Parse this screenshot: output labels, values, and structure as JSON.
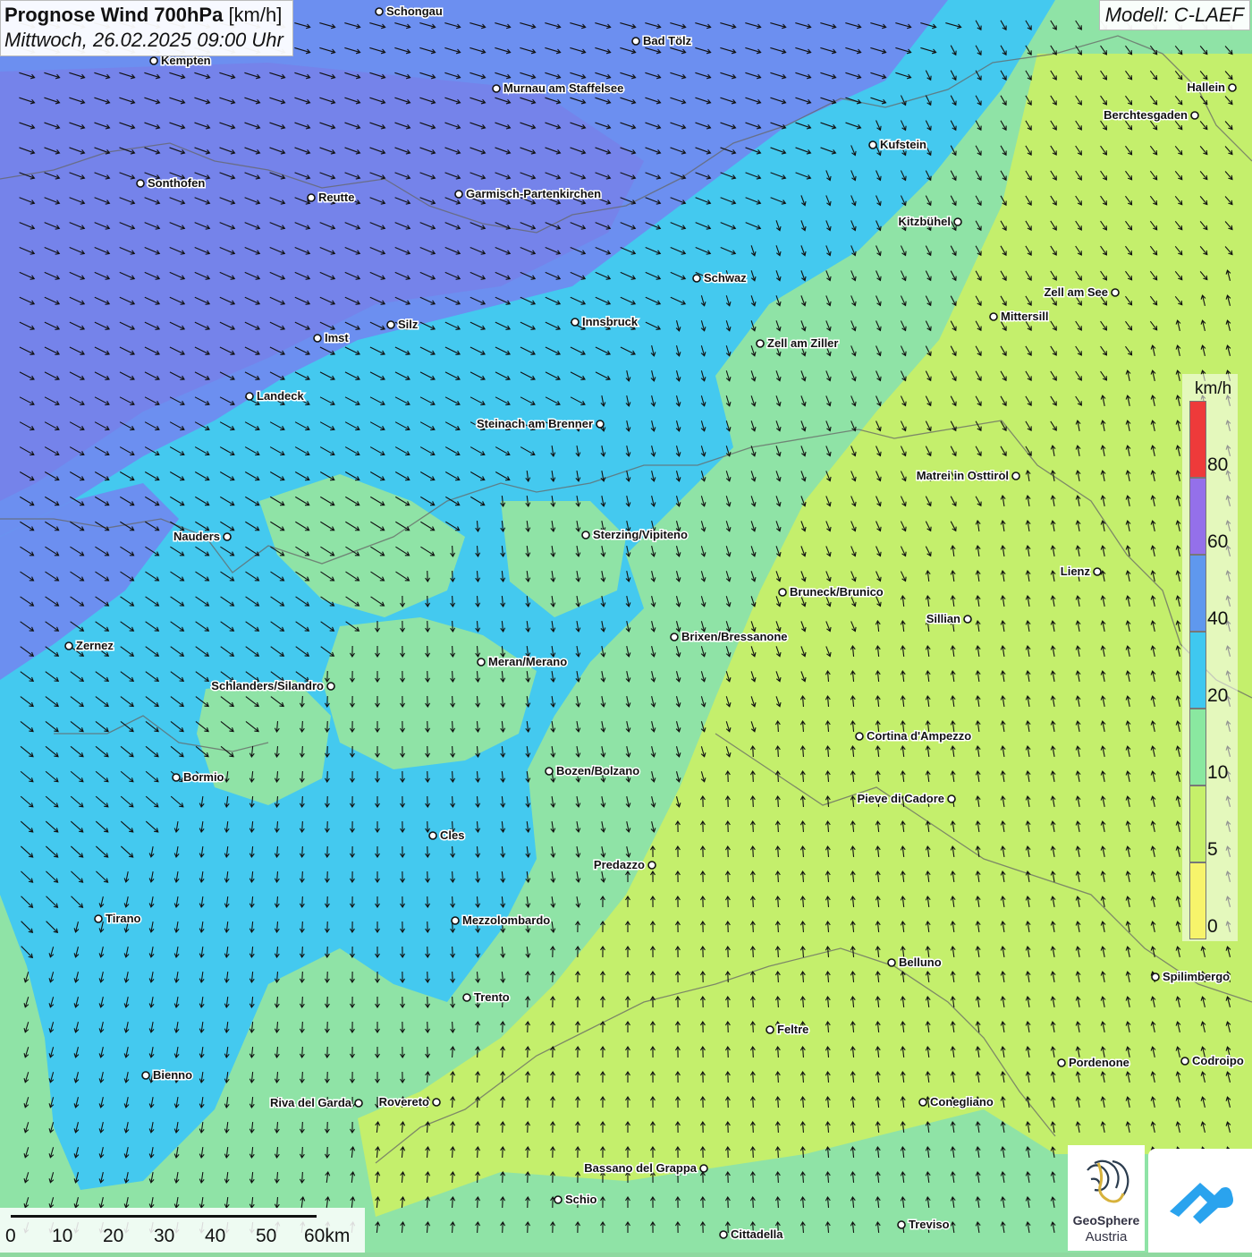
{
  "header": {
    "title_bold": "Prognose Wind 700hPa",
    "title_unit": "[km/h]",
    "datetime": "Mittwoch, 26.02.2025 09:00 Uhr",
    "model": "Modell: C-LAEF"
  },
  "legend": {
    "unit": "km/h",
    "ticks": [
      "0",
      "5",
      "10",
      "20",
      "40",
      "60",
      "80"
    ],
    "colors": [
      "#f7f46b",
      "#c6f06a",
      "#8ae8a0",
      "#3fc8f0",
      "#5f98ee",
      "#9470ea",
      "#ee3a3a"
    ]
  },
  "scale_bar": {
    "labels": [
      "0",
      "10",
      "20",
      "30",
      "40",
      "50",
      "60km"
    ]
  },
  "logo": {
    "name_line1": "GeoSphere",
    "name_line2": "Austria"
  },
  "cities": [
    {
      "name": "Schongau"
    },
    {
      "name": "Bad Tölz"
    },
    {
      "name": "Kempten"
    },
    {
      "name": "Murnau am Staffelsee"
    },
    {
      "name": "Hallein"
    },
    {
      "name": "Berchtesgaden"
    },
    {
      "name": "Kufstein"
    },
    {
      "name": "Sonthofen"
    },
    {
      "name": "Reutte"
    },
    {
      "name": "Garmisch-Partenkirchen"
    },
    {
      "name": "Kitzbühel"
    },
    {
      "name": "Schwaz"
    },
    {
      "name": "Zell am See"
    },
    {
      "name": "Mittersill"
    },
    {
      "name": "Innsbruck"
    },
    {
      "name": "Silz"
    },
    {
      "name": "Imst"
    },
    {
      "name": "Zell am Ziller"
    },
    {
      "name": "Landeck"
    },
    {
      "name": "Steinach am Brenner"
    },
    {
      "name": "Matrei in Osttirol"
    },
    {
      "name": "Nauders"
    },
    {
      "name": "Sterzing/Vipiteno"
    },
    {
      "name": "Lienz"
    },
    {
      "name": "Bruneck/Brunico"
    },
    {
      "name": "Sillian"
    },
    {
      "name": "Brixen/Bressanone"
    },
    {
      "name": "Zernez"
    },
    {
      "name": "Meran/Merano"
    },
    {
      "name": "Schlanders/Silandro"
    },
    {
      "name": "Cortina d'Ampezzo"
    },
    {
      "name": "Bozen/Bolzano"
    },
    {
      "name": "Bormio"
    },
    {
      "name": "Pieve di Cadore"
    },
    {
      "name": "Cles"
    },
    {
      "name": "Predazzo"
    },
    {
      "name": "Tirano"
    },
    {
      "name": "Mezzolombardo"
    },
    {
      "name": "Belluno"
    },
    {
      "name": "Spilimbergo"
    },
    {
      "name": "Trento"
    },
    {
      "name": "Feltre"
    },
    {
      "name": "Pordenone"
    },
    {
      "name": "Codroipo"
    },
    {
      "name": "Bienno"
    },
    {
      "name": "Riva del Garda"
    },
    {
      "name": "Rovereto"
    },
    {
      "name": "Conegliano"
    },
    {
      "name": "Bassano del Grappa"
    },
    {
      "name": "Schio"
    },
    {
      "name": "Treviso"
    },
    {
      "name": "Cittadella"
    }
  ]
}
